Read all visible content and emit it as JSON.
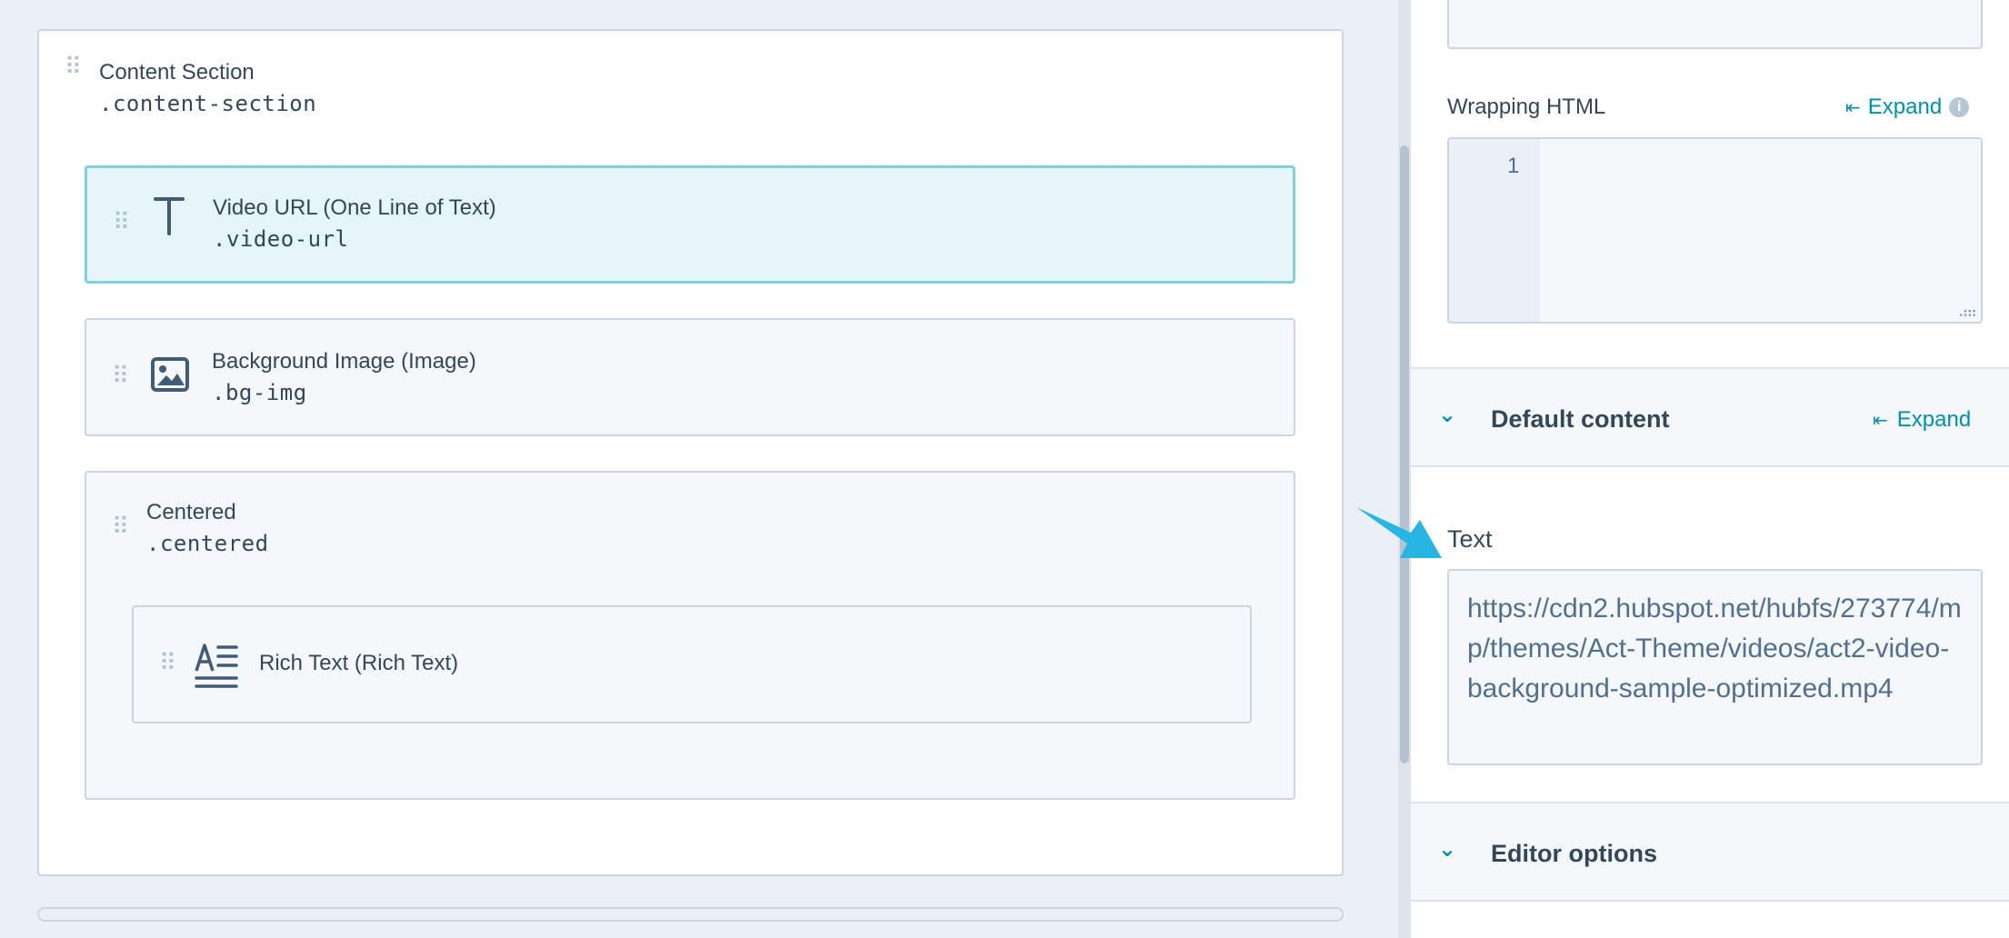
{
  "module": {
    "section": {
      "label": "Content Section",
      "class_name": ".content-section"
    },
    "fields": [
      {
        "label": "Video URL (One Line of Text)",
        "class_name": ".video-url",
        "icon": "text-field-icon",
        "selected": true
      },
      {
        "label": "Background Image (Image)",
        "class_name": ".bg-img",
        "icon": "image-field-icon",
        "selected": false
      }
    ],
    "group": {
      "label": "Centered",
      "class_name": ".centered",
      "child": {
        "label": "Rich Text (Rich Text)",
        "icon": "rich-text-field-icon"
      }
    }
  },
  "sidebar": {
    "wrapping_html": {
      "label": "Wrapping HTML",
      "expand_label": "Expand",
      "line_number": "1"
    },
    "default_content": {
      "title": "Default content",
      "expand_label": "Expand"
    },
    "text_field": {
      "label": "Text",
      "value": "https://cdn2.hubspot.net/hubfs/273774/mp/themes/Act-Theme/videos/act2-video-background-sample-optimized.mp4"
    },
    "editor_options": {
      "title": "Editor options"
    }
  },
  "colors": {
    "accent": "#0091ae",
    "selected_bg": "#e5f5f8",
    "selected_border": "#7fd1de",
    "arrow": "#27b6e3"
  }
}
